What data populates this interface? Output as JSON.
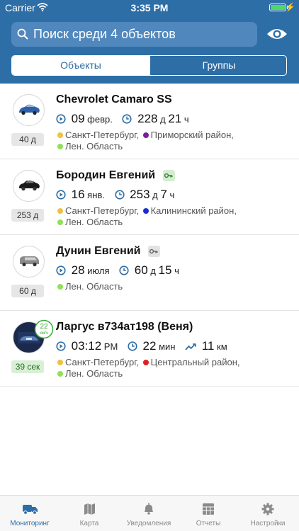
{
  "status_bar": {
    "carrier": "Carrier",
    "time": "3:35 PM"
  },
  "search": {
    "placeholder": "Поиск среди 4 объектов"
  },
  "segments": {
    "objects": "Объекты",
    "groups": "Группы"
  },
  "objects": [
    {
      "name": "Chevrolet Camaro SS",
      "age": "40 д",
      "date_num": "09",
      "date_unit": "февр.",
      "duration_num": "228",
      "duration_unit": "д",
      "duration_num2": "21",
      "duration_unit2": "ч",
      "addr_line1_a": "Санкт-Петербург,",
      "addr_line1_b": "Приморский район,",
      "addr_line2": "Лен. Область"
    },
    {
      "name": "Бородин Евгений",
      "age": "253 д",
      "date_num": "16",
      "date_unit": "янв.",
      "duration_num": "253",
      "duration_unit": "д",
      "duration_num2": "7",
      "duration_unit2": "ч",
      "addr_line1_a": "Санкт-Петербург,",
      "addr_line1_b": "Калининский район,",
      "addr_line2": "Лен. Область"
    },
    {
      "name": "Дунин Евгений",
      "age": "60 д",
      "date_num": "28",
      "date_unit": "июля",
      "duration_num": "60",
      "duration_unit": "д",
      "duration_num2": "15",
      "duration_unit2": "ч",
      "addr_line1": "Лен. Область"
    },
    {
      "name": "Ларгус в734ат198 (Веня)",
      "age": "39 сек",
      "speed_value": "22",
      "speed_unit": "км/ч",
      "time_num": "03:12",
      "time_unit": "PM",
      "duration_num": "22",
      "duration_unit": "мин",
      "distance_num": "11",
      "distance_unit": "км",
      "addr_line1_a": "Санкт-Петербург,",
      "addr_line1_b": "Центральный район,",
      "addr_line2": "Лен. Область"
    }
  ],
  "tabs": [
    "Мониторинг",
    "Карта",
    "Уведомления",
    "Отчеты",
    "Настройки"
  ],
  "colors": {
    "header": "#2e6ea6",
    "dot_yellow": "#f0c040",
    "dot_green": "#8fe05a",
    "dot_purple": "#7a1fa0",
    "dot_blue": "#1a2fd0",
    "dot_red": "#e02020",
    "icon_blue": "#2e6ea6",
    "speed_green": "#3cab3c"
  },
  "icons": {
    "status": [
      "wifi-icon",
      "battery-icon",
      "charging-icon"
    ],
    "header": [
      "search-icon",
      "eye-icon"
    ],
    "stats": [
      "play-icon",
      "clock-icon",
      "trend-icon"
    ],
    "tabs": [
      "truck-icon",
      "map-icon",
      "bell-icon",
      "table-icon",
      "gear-icon"
    ]
  }
}
